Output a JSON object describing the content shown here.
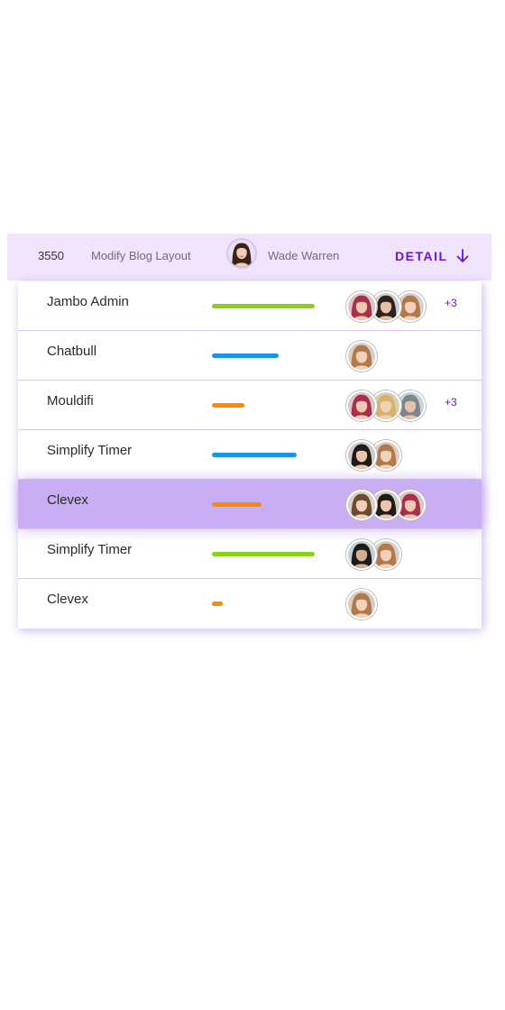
{
  "header": {
    "id": "3550",
    "task": "Modify Blog Layout",
    "user": "Wade Warren",
    "detail_label": "DETAIL",
    "arrow_icon": "arrow-down-icon",
    "accent_color": "#6a14d9"
  },
  "rows": [
    {
      "name": "Jambo Admin",
      "progress": 0.96,
      "bar_color": "#8bd01a",
      "avatars": [
        "avatar-red-hair",
        "avatar-dark-hair",
        "avatar-blonde"
      ],
      "more": "+3",
      "active": false
    },
    {
      "name": "Chatbull",
      "progress": 0.62,
      "bar_color": "#1a93e8",
      "avatars": [
        "avatar-blonde"
      ],
      "more": "",
      "active": false
    },
    {
      "name": "Mouldifi",
      "progress": 0.3,
      "bar_color": "#ff8a00",
      "avatars": [
        "avatar-red-hair",
        "avatar-blonde-curly",
        "avatar-man-grey"
      ],
      "more": "+3",
      "active": false
    },
    {
      "name": "Simplify Timer",
      "progress": 0.79,
      "bar_color": "#1a93e8",
      "avatars": [
        "avatar-hat",
        "avatar-blonde"
      ],
      "more": "",
      "active": false
    },
    {
      "name": "Clevex",
      "progress": 0.46,
      "bar_color": "#ff8a00",
      "avatars": [
        "avatar-brown-hair",
        "avatar-hat",
        "avatar-red-hair"
      ],
      "more": "",
      "active": true
    },
    {
      "name": "Simplify Timer",
      "progress": 0.96,
      "bar_color": "#8bd01a",
      "avatars": [
        "avatar-man-dark",
        "avatar-blonde"
      ],
      "more": "",
      "active": false
    },
    {
      "name": "Clevex",
      "progress": 0.1,
      "bar_color": "#ff8a00",
      "avatars": [
        "avatar-blonde"
      ],
      "more": "",
      "active": false
    }
  ]
}
